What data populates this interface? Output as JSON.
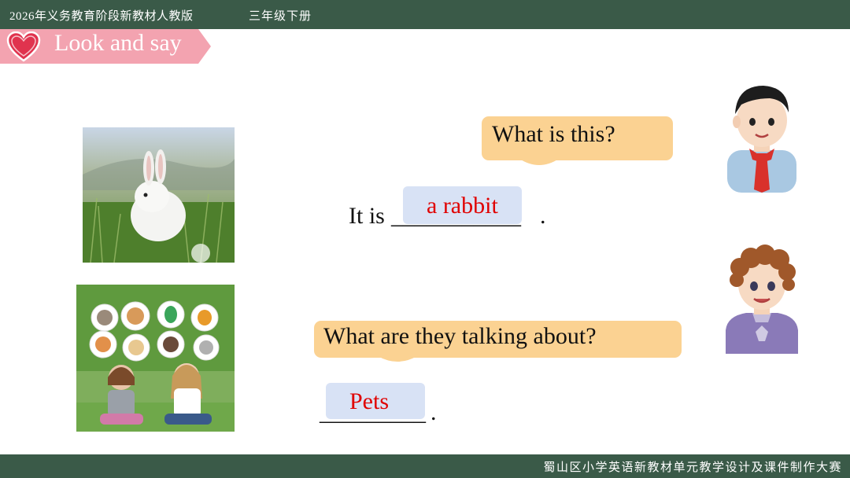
{
  "header": {
    "left_text": "2026年义务教育阶段新教材人教版",
    "grade_text": "三年级下册"
  },
  "section": {
    "title": "Look and say"
  },
  "footer": {
    "right_text": "蜀山区小学英语新教材单元教学设计及课件制作大赛"
  },
  "dialogue1": {
    "question": "What is this?",
    "sentence_prefix": "It is",
    "blank": "___________",
    "period": ".",
    "answer": "a rabbit"
  },
  "dialogue2": {
    "question": "What are they talking about?",
    "blank": "_________",
    "period": ".",
    "answer": "Pets"
  },
  "colors": {
    "bar": "#3a5a48",
    "title_pink": "#f3a3b0",
    "bubble": "#fbd292",
    "answer_box": "#d8e2f5",
    "answer_text": "#e00000"
  },
  "icons": {
    "title_icon": "heart-icon"
  }
}
